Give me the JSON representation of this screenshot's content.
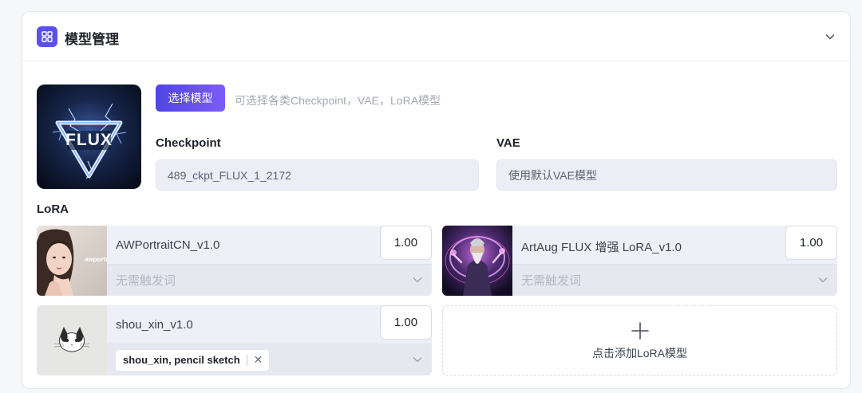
{
  "panel": {
    "title": "模型管理",
    "icon": "grid-icon",
    "accent": "#5b4ff0"
  },
  "model": {
    "thumb_text": "FLUX",
    "select_button": "选择模型",
    "select_hint": "可选择各类Checkpoint，VAE，LoRA模型",
    "checkpoint_label": "Checkpoint",
    "checkpoint_value": "489_ckpt_FLUX_1_2172",
    "vae_label": "VAE",
    "vae_value": "使用默认VAE模型"
  },
  "lora": {
    "section_label": "LoRA",
    "items": [
      {
        "name": "AWPortraitCN_v1.0",
        "weight": "1.00",
        "trigger_placeholder": "无需触发词",
        "thumb_text": "awportr"
      },
      {
        "name": "ArtAug FLUX 增强 LoRA_v1.0",
        "weight": "1.00",
        "trigger_placeholder": "无需触发词"
      },
      {
        "name": "shou_xin_v1.0",
        "weight": "1.00",
        "trigger_tag": "shou_xin, pencil sketch"
      }
    ],
    "add_label": "点击添加LoRA模型"
  }
}
